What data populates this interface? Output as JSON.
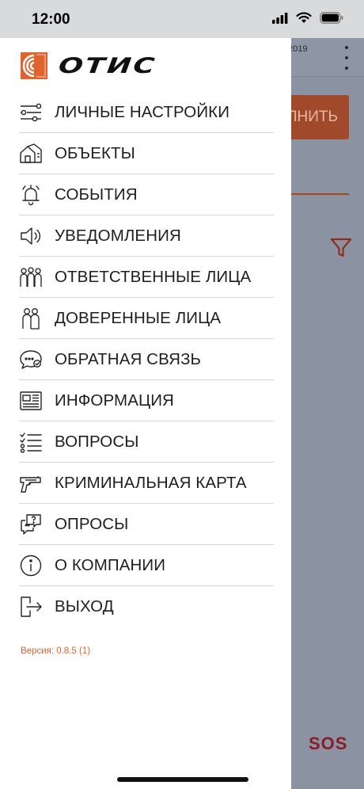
{
  "status_bar": {
    "time": "12:00"
  },
  "background": {
    "date_fragment": "2019",
    "button_fragment": "ЛНИТЬ",
    "sos_label": "SOS"
  },
  "brand": {
    "logo_text": "ОТИС",
    "accent_color": "#e0622c"
  },
  "menu": {
    "items": [
      {
        "label": "ЛИЧНЫЕ НАСТРОЙКИ",
        "icon": "sliders-icon"
      },
      {
        "label": "ОБЪЕКТЫ",
        "icon": "buildings-icon"
      },
      {
        "label": "СОБЫТИЯ",
        "icon": "alarm-bell-icon"
      },
      {
        "label": "УВЕДОМЛЕНИЯ",
        "icon": "speaker-icon"
      },
      {
        "label": "ОТВЕТСТВЕННЫЕ ЛИЦА",
        "icon": "people-group-icon"
      },
      {
        "label": "ДОВЕРЕННЫЕ ЛИЦА",
        "icon": "people-pair-icon"
      },
      {
        "label": "ОБРАТНАЯ СВЯЗЬ",
        "icon": "chat-bubble-icon"
      },
      {
        "label": "ИНФОРМАЦИЯ",
        "icon": "newspaper-icon"
      },
      {
        "label": "ВОПРОСЫ",
        "icon": "checklist-icon"
      },
      {
        "label": "КРИМИНАЛЬНАЯ КАРТА",
        "icon": "pistol-icon"
      },
      {
        "label": "ОПРОСЫ",
        "icon": "survey-bubble-icon"
      },
      {
        "label": "О КОМПАНИИ",
        "icon": "info-icon"
      },
      {
        "label": "ВЫХОД",
        "icon": "logout-icon"
      }
    ]
  },
  "version_text": "Версия: 0.8.5 (1)"
}
